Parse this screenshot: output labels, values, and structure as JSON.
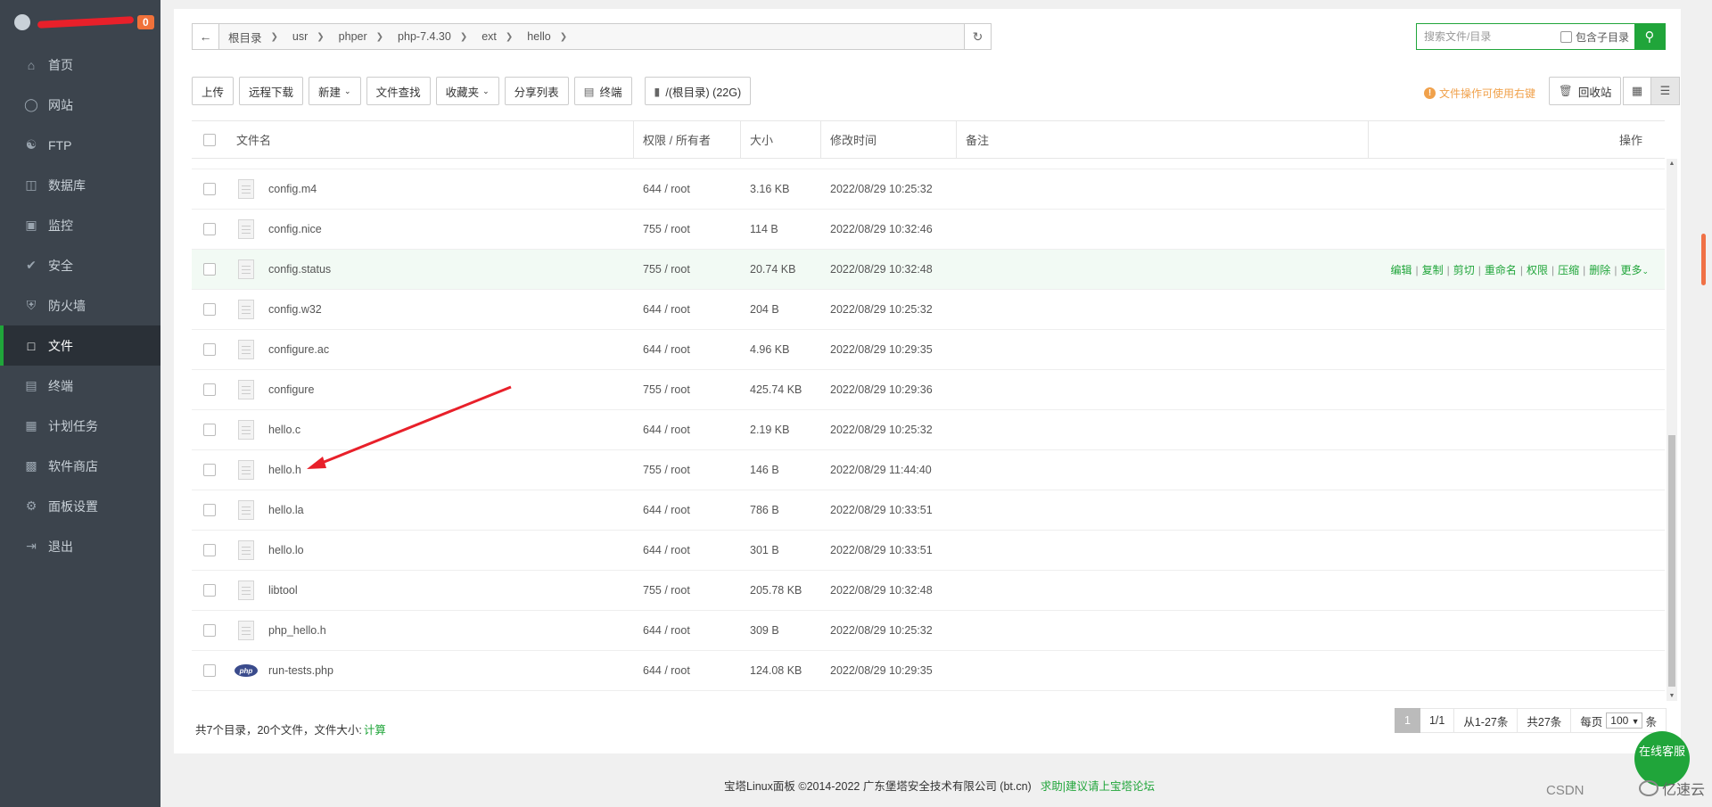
{
  "sidebar": {
    "badge": "0",
    "items": [
      {
        "label": "首页",
        "icon": "home-icon"
      },
      {
        "label": "网站",
        "icon": "globe-icon"
      },
      {
        "label": "FTP",
        "icon": "ftp-icon"
      },
      {
        "label": "数据库",
        "icon": "database-icon"
      },
      {
        "label": "监控",
        "icon": "monitor-icon"
      },
      {
        "label": "安全",
        "icon": "shield-check-icon"
      },
      {
        "label": "防火墙",
        "icon": "firewall-icon"
      },
      {
        "label": "文件",
        "icon": "folder-icon",
        "active": true
      },
      {
        "label": "终端",
        "icon": "terminal-icon"
      },
      {
        "label": "计划任务",
        "icon": "calendar-icon"
      },
      {
        "label": "软件商店",
        "icon": "apps-icon"
      },
      {
        "label": "面板设置",
        "icon": "gear-icon"
      },
      {
        "label": "退出",
        "icon": "logout-icon"
      }
    ]
  },
  "breadcrumb": [
    "根目录",
    "usr",
    "phper",
    "php-7.4.30",
    "ext",
    "hello"
  ],
  "search": {
    "placeholder": "搜索文件/目录",
    "include_sub": "包含子目录"
  },
  "toolbar": {
    "upload": "上传",
    "remote_download": "远程下载",
    "new": "新建",
    "find": "文件查找",
    "favorites": "收藏夹",
    "share_list": "分享列表",
    "terminal": "终端",
    "disk": "/(根目录) (22G)"
  },
  "tip": "文件操作可使用右键",
  "recycle": "回收站",
  "table": {
    "headers": {
      "name": "文件名",
      "perm": "权限 / 所有者",
      "size": "大小",
      "mtime": "修改时间",
      "note": "备注",
      "ops": "操作"
    },
    "rows": [
      {
        "name": "config.m4",
        "perm": "644 / root",
        "size": "3.16 KB",
        "mtime": "2022/08/29 10:25:32"
      },
      {
        "name": "config.nice",
        "perm": "755 / root",
        "size": "114 B",
        "mtime": "2022/08/29 10:32:46"
      },
      {
        "name": "config.status",
        "perm": "755 / root",
        "size": "20.74 KB",
        "mtime": "2022/08/29 10:32:48"
      },
      {
        "name": "config.w32",
        "perm": "644 / root",
        "size": "204 B",
        "mtime": "2022/08/29 10:25:32"
      },
      {
        "name": "configure.ac",
        "perm": "644 / root",
        "size": "4.96 KB",
        "mtime": "2022/08/29 10:29:35"
      },
      {
        "name": "configure",
        "perm": "755 / root",
        "size": "425.74 KB",
        "mtime": "2022/08/29 10:29:36"
      },
      {
        "name": "hello.c",
        "perm": "644 / root",
        "size": "2.19 KB",
        "mtime": "2022/08/29 10:25:32"
      },
      {
        "name": "hello.h",
        "perm": "755 / root",
        "size": "146 B",
        "mtime": "2022/08/29 11:44:40"
      },
      {
        "name": "hello.la",
        "perm": "644 / root",
        "size": "786 B",
        "mtime": "2022/08/29 10:33:51"
      },
      {
        "name": "hello.lo",
        "perm": "644 / root",
        "size": "301 B",
        "mtime": "2022/08/29 10:33:51"
      },
      {
        "name": "libtool",
        "perm": "755 / root",
        "size": "205.78 KB",
        "mtime": "2022/08/29 10:32:48"
      },
      {
        "name": "php_hello.h",
        "perm": "644 / root",
        "size": "309 B",
        "mtime": "2022/08/29 10:25:32"
      },
      {
        "name": "run-tests.php",
        "perm": "644 / root",
        "size": "124.08 KB",
        "mtime": "2022/08/29 10:29:35"
      }
    ],
    "row_actions": [
      "编辑",
      "复制",
      "剪切",
      "重命名",
      "权限",
      "压缩",
      "删除",
      "更多"
    ]
  },
  "summary": {
    "text": "共7个目录，20个文件，文件大小:",
    "calc": "计算"
  },
  "pager": {
    "current": "1",
    "pages": "1/1",
    "range": "从1-27条",
    "total": "共27条",
    "per_page_label": "每页",
    "per_page": "100",
    "unit": "条"
  },
  "footer": {
    "copyright": "宝塔Linux面板 ©2014-2022 广东堡塔安全技术有限公司 (bt.cn)",
    "link": "求助|建议请上宝塔论坛"
  },
  "online_service": "在线客服",
  "watermarks": {
    "csdn": "CSDN",
    "yisu": "亿速云"
  }
}
